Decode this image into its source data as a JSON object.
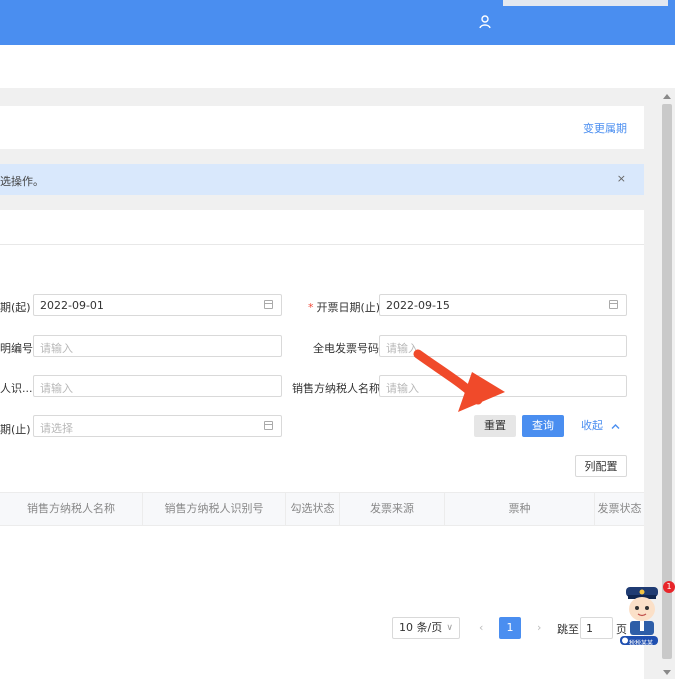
{
  "header": {
    "user_icon": "user-icon"
  },
  "card1": {
    "link_label": "变更属期"
  },
  "alert": {
    "text": "选操作。",
    "close_label": "×"
  },
  "form": {
    "row1": {
      "left_label": "期(起)",
      "left_value": "2022-09-01",
      "right_label": "开票日期(止)",
      "right_required": "*",
      "right_value": "2022-09-15"
    },
    "row2": {
      "left_label": "明编号",
      "left_placeholder": "请输入",
      "right_label": "全电发票号码",
      "right_placeholder": "请输入"
    },
    "row3": {
      "left_label": "人识...",
      "left_placeholder": "请输入",
      "right_label": "销售方纳税人名称",
      "right_placeholder": "请输入"
    },
    "row4": {
      "left_label": "期(止)",
      "left_placeholder": "请选择"
    },
    "buttons": {
      "reset": "重置",
      "query": "查询",
      "collapse": "收起",
      "column_config": "列配置"
    }
  },
  "table": {
    "columns": [
      "销售方纳税人名称",
      "销售方纳税人识别号",
      "勾选状态",
      "发票来源",
      "票种",
      "发票状态"
    ]
  },
  "pagination": {
    "page_size": "10 条/页",
    "prev": "‹",
    "current_page": "1",
    "next": "›",
    "jump_label": "跳至",
    "jump_value": "1",
    "page_suffix": "页"
  },
  "assistant": {
    "badge_count": "1",
    "caption": "税税某某"
  },
  "colors": {
    "primary": "#4a8ef0",
    "alert_bg": "#d9e8fc",
    "arrow": "#f04a2a"
  }
}
